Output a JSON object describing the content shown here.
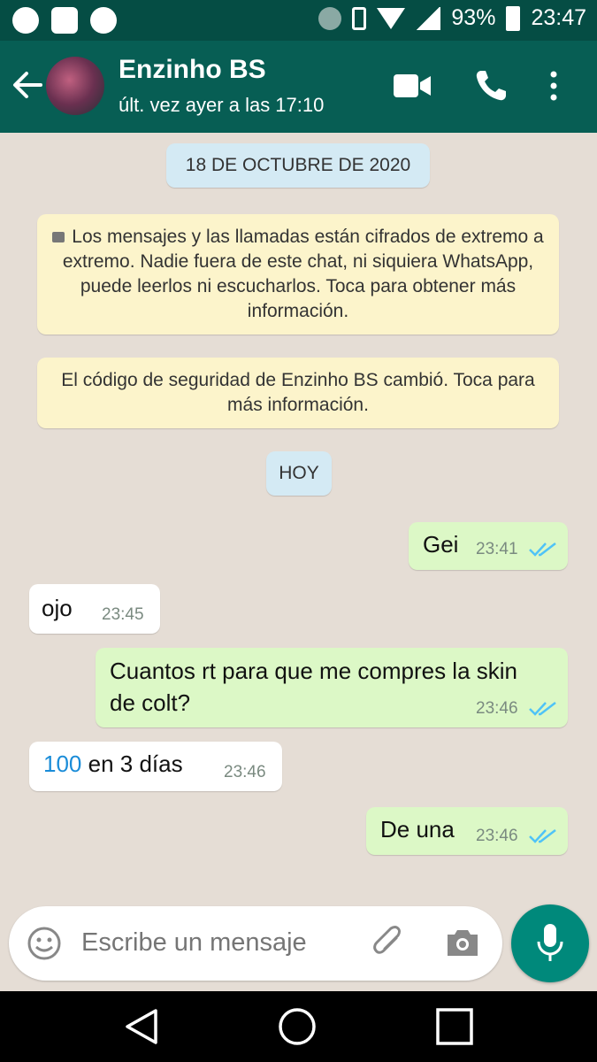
{
  "status_bar": {
    "battery": "93%",
    "time": "23:47"
  },
  "header": {
    "contact_name": "Enzinho BS",
    "last_seen": "últ. vez ayer a las 17:10"
  },
  "chat": {
    "date_chip_1": "18 DE OCTUBRE DE 2020",
    "encryption_notice": "Los mensajes y las llamadas están cifrados de extremo a extremo. Nadie fuera de este chat, ni siquiera WhatsApp, puede leerlos ni escucharlos. Toca para obtener más información.",
    "security_notice": "El código de seguridad de Enzinho BS cambió. Toca para más información.",
    "date_chip_2": "HOY",
    "messages": [
      {
        "direction": "out",
        "text": "Gei",
        "time": "23:41",
        "read": true
      },
      {
        "direction": "in",
        "text": "ojo",
        "time": "23:45"
      },
      {
        "direction": "out",
        "text": "Cuantos rt para que me compres la skin de colt?",
        "time": "23:46",
        "read": true
      },
      {
        "direction": "in",
        "link": "100",
        "text": " en 3 días",
        "time": "23:46"
      },
      {
        "direction": "out",
        "text": "De una",
        "time": "23:46",
        "read": true
      }
    ]
  },
  "composer": {
    "placeholder": "Escribe un mensaje"
  },
  "colors": {
    "header": "#075e54",
    "status_bar": "#054d44",
    "outgoing_bubble": "#dcf8c6",
    "incoming_bubble": "#ffffff",
    "system_bubble": "#fcf4cb",
    "date_chip": "#d4eaf4",
    "read_ticks": "#4fc3f7",
    "mic_button": "#00897b"
  }
}
